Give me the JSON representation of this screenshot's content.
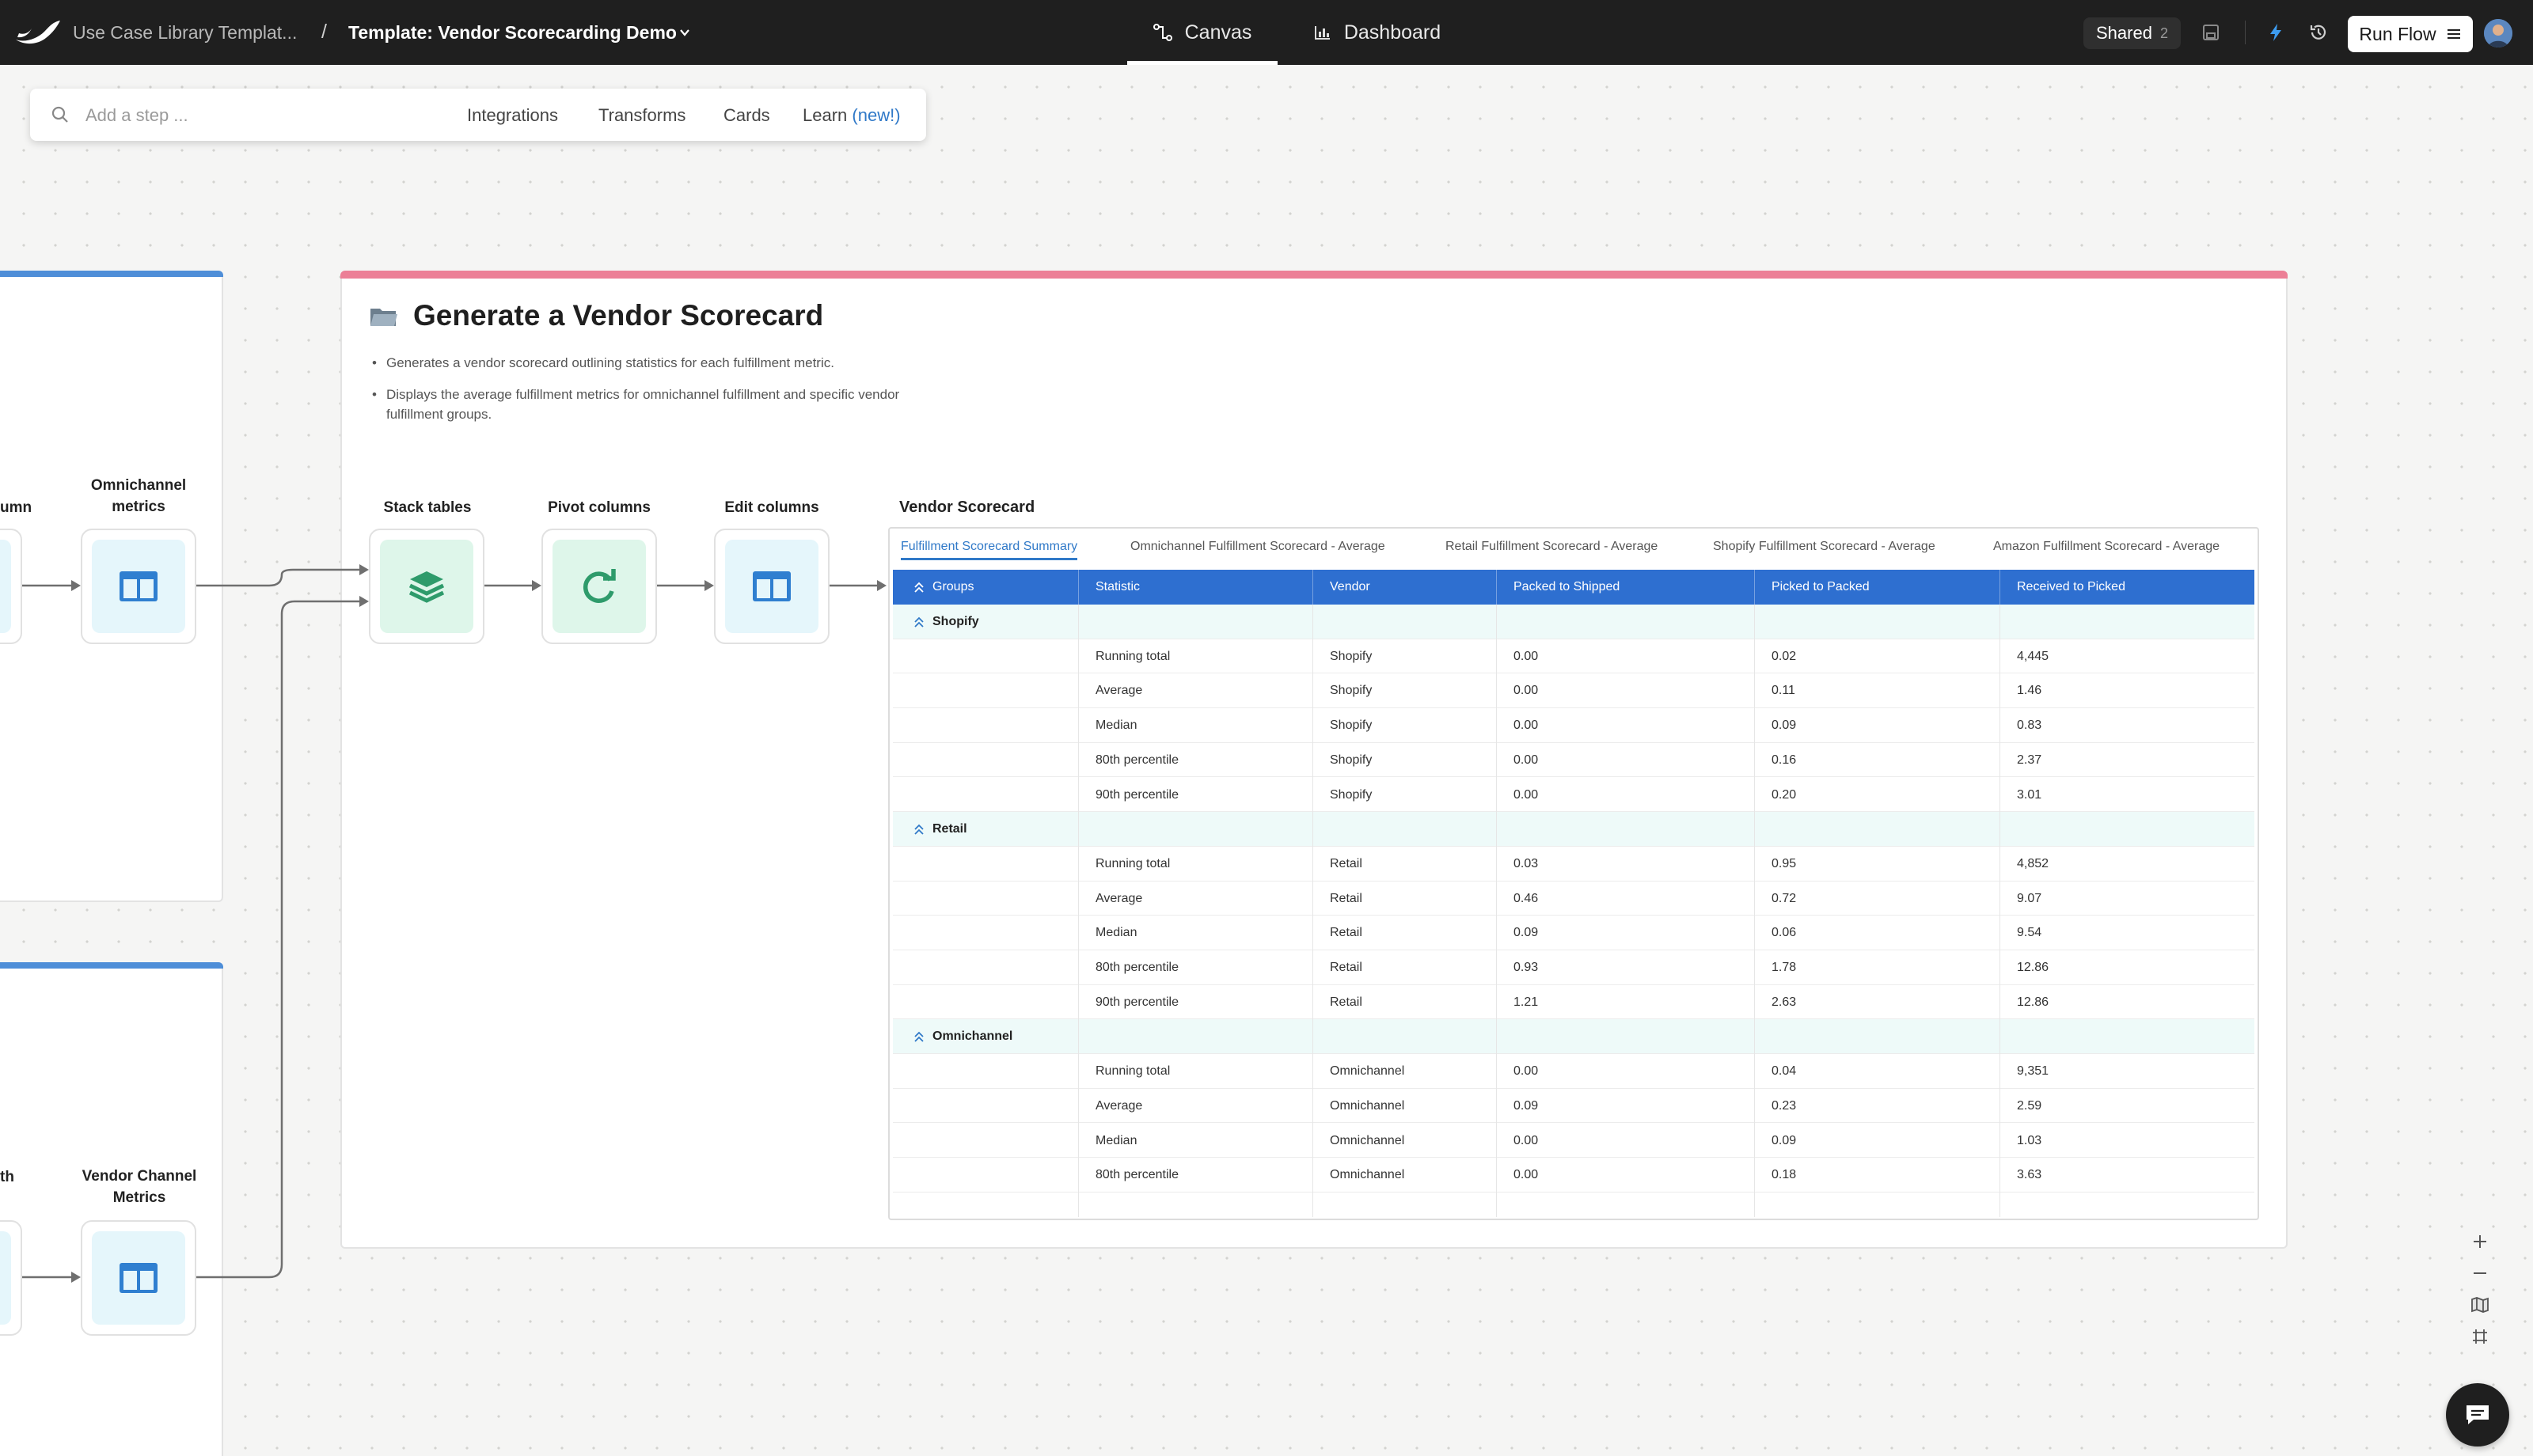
{
  "topbar": {
    "breadcrumb_parent": "Use Case Library Templat...",
    "breadcrumb_separator": "/",
    "breadcrumb_current": "Template: Vendor Scorecarding Demo",
    "tab_canvas": "Canvas",
    "tab_dashboard": "Dashboard",
    "shared_label": "Shared",
    "shared_count": "2",
    "run_flow_label": "Run Flow"
  },
  "stepbar": {
    "placeholder": "Add a step ...",
    "integrations": "Integrations",
    "transforms": "Transforms",
    "cards": "Cards",
    "learn": "Learn",
    "learn_badge": "(new!)"
  },
  "left_panel": {
    "node_top_partial_label": "umn",
    "node_omni_label_1": "Omnichannel",
    "node_omni_label_2": "metrics",
    "node_bottom_partial_label": "th",
    "node_vendor_label_1": "Vendor Channel",
    "node_vendor_label_2": "Metrics"
  },
  "scorecard_card": {
    "title": "Generate a Vendor Scorecard",
    "bullets": [
      "Generates a vendor scorecard outlining statistics for each fulfillment metric.",
      "Displays the average fulfillment metrics for omnichannel fulfillment and specific vendor fulfillment groups."
    ],
    "nodes": {
      "stack_tables": "Stack tables",
      "pivot_columns": "Pivot columns",
      "edit_columns": "Edit columns"
    }
  },
  "table": {
    "title": "Vendor Scorecard",
    "tabs": [
      "Fulfillment Scorecard Summary",
      "Omnichannel Fulfillment Scorecard - Average",
      "Retail Fulfillment Scorecard - Average",
      "Shopify Fulfillment Scorecard - Average",
      "Amazon Fulfillment Scorecard - Average"
    ],
    "columns": [
      "Groups",
      "Statistic",
      "Vendor",
      "Packed to Shipped",
      "Picked to Packed",
      "Received to Picked"
    ],
    "groups": [
      {
        "name": "Shopify",
        "rows": [
          [
            "Running total",
            "Shopify",
            "0.00",
            "0.02",
            "4,445"
          ],
          [
            "Average",
            "Shopify",
            "0.00",
            "0.11",
            "1.46"
          ],
          [
            "Median",
            "Shopify",
            "0.00",
            "0.09",
            "0.83"
          ],
          [
            "80th percentile",
            "Shopify",
            "0.00",
            "0.16",
            "2.37"
          ],
          [
            "90th percentile",
            "Shopify",
            "0.00",
            "0.20",
            "3.01"
          ]
        ]
      },
      {
        "name": "Retail",
        "rows": [
          [
            "Running total",
            "Retail",
            "0.03",
            "0.95",
            "4,852"
          ],
          [
            "Average",
            "Retail",
            "0.46",
            "0.72",
            "9.07"
          ],
          [
            "Median",
            "Retail",
            "0.09",
            "0.06",
            "9.54"
          ],
          [
            "80th percentile",
            "Retail",
            "0.93",
            "1.78",
            "12.86"
          ],
          [
            "90th percentile",
            "Retail",
            "1.21",
            "2.63",
            "12.86"
          ]
        ]
      },
      {
        "name": "Omnichannel",
        "rows": [
          [
            "Running total",
            "Omnichannel",
            "0.00",
            "0.04",
            "9,351"
          ],
          [
            "Average",
            "Omnichannel",
            "0.09",
            "0.23",
            "2.59"
          ],
          [
            "Median",
            "Omnichannel",
            "0.00",
            "0.09",
            "1.03"
          ],
          [
            "80th percentile",
            "Omnichannel",
            "0.00",
            "0.18",
            "3.63"
          ]
        ]
      }
    ]
  },
  "colors": {
    "topbar_bg": "#1f1f1f",
    "accent_blue": "#3079c8",
    "table_header_bg": "#2e6fd0",
    "card_accent_pink": "#ec7f96",
    "card_accent_blue": "#4e8ed8",
    "group_row_bg": "#eefaf9",
    "node_blue_bg": "#e5f6fb",
    "node_green_bg": "#def6ea"
  },
  "icons": [
    "logo-icon",
    "chevron-down-icon",
    "canvas-flow-icon",
    "dashboard-chart-icon",
    "save-icon",
    "lightning-icon",
    "history-icon",
    "menu-icon",
    "search-icon",
    "folder-icon",
    "columns-icon",
    "layers-icon",
    "refresh-icon",
    "sort-icon",
    "zoom-in-icon",
    "zoom-out-icon",
    "minimap-icon",
    "fit-view-icon",
    "chat-icon"
  ]
}
